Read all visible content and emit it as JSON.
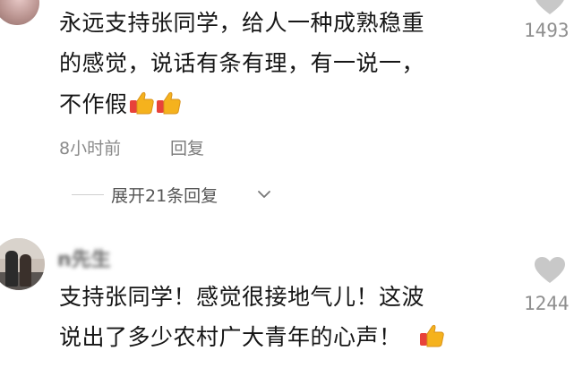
{
  "comments": [
    {
      "lines": [
        "永远支持张同学，给人一种成熟稳重",
        "的感觉，说话有条有理，有一说一，",
        "不作假"
      ],
      "emoji_count": 2,
      "time": "8小时前",
      "reply_label": "回复",
      "expand_label": "展开21条回复",
      "likes": "1493"
    },
    {
      "username": "n先生",
      "lines": [
        "支持张同学！感觉很接地气儿！这波",
        "说出了多少农村广大青年的心声！"
      ],
      "emoji_count": 1,
      "likes": "1244"
    }
  ],
  "icons": {
    "like": "heart-icon",
    "emoji": "thumbs-up-emoji",
    "expand": "chevron-down-icon"
  },
  "colors": {
    "text": "#161616",
    "meta": "#8a8a8a",
    "heart": "#c8c8c8",
    "emoji_fill": "#f5b21d",
    "emoji_cuff": "#e8423a"
  }
}
